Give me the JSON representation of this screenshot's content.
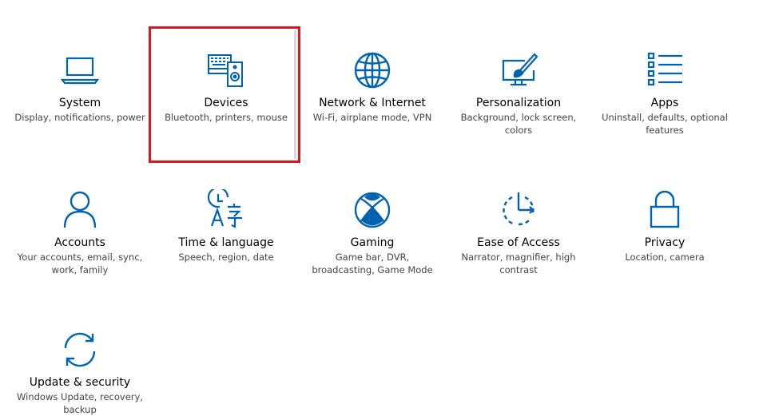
{
  "colors": {
    "accent": "#0063b1",
    "highlight": "#e0141e"
  },
  "tiles": [
    {
      "id": "system",
      "title": "System",
      "desc": "Display, notifications, power",
      "icon": "laptop-icon"
    },
    {
      "id": "devices",
      "title": "Devices",
      "desc": "Bluetooth, printers, mouse",
      "icon": "devices-icon"
    },
    {
      "id": "network",
      "title": "Network & Internet",
      "desc": "Wi-Fi, airplane mode, VPN",
      "icon": "globe-icon"
    },
    {
      "id": "personalization",
      "title": "Personalization",
      "desc": "Background, lock screen, colors",
      "icon": "paint-brush-icon"
    },
    {
      "id": "apps",
      "title": "Apps",
      "desc": "Uninstall, defaults, optional features",
      "icon": "apps-list-icon"
    },
    {
      "id": "accounts",
      "title": "Accounts",
      "desc": "Your accounts, email, sync, work, family",
      "icon": "person-icon"
    },
    {
      "id": "time-language",
      "title": "Time & language",
      "desc": "Speech, region, date",
      "icon": "time-language-icon"
    },
    {
      "id": "gaming",
      "title": "Gaming",
      "desc": "Game bar, DVR, broadcasting, Game Mode",
      "icon": "xbox-icon"
    },
    {
      "id": "ease-of-access",
      "title": "Ease of Access",
      "desc": "Narrator, magnifier, high contrast",
      "icon": "ease-of-access-icon"
    },
    {
      "id": "privacy",
      "title": "Privacy",
      "desc": "Location, camera",
      "icon": "lock-icon"
    },
    {
      "id": "update-security",
      "title": "Update & security",
      "desc": "Windows Update, recovery, backup",
      "icon": "sync-icon"
    }
  ]
}
